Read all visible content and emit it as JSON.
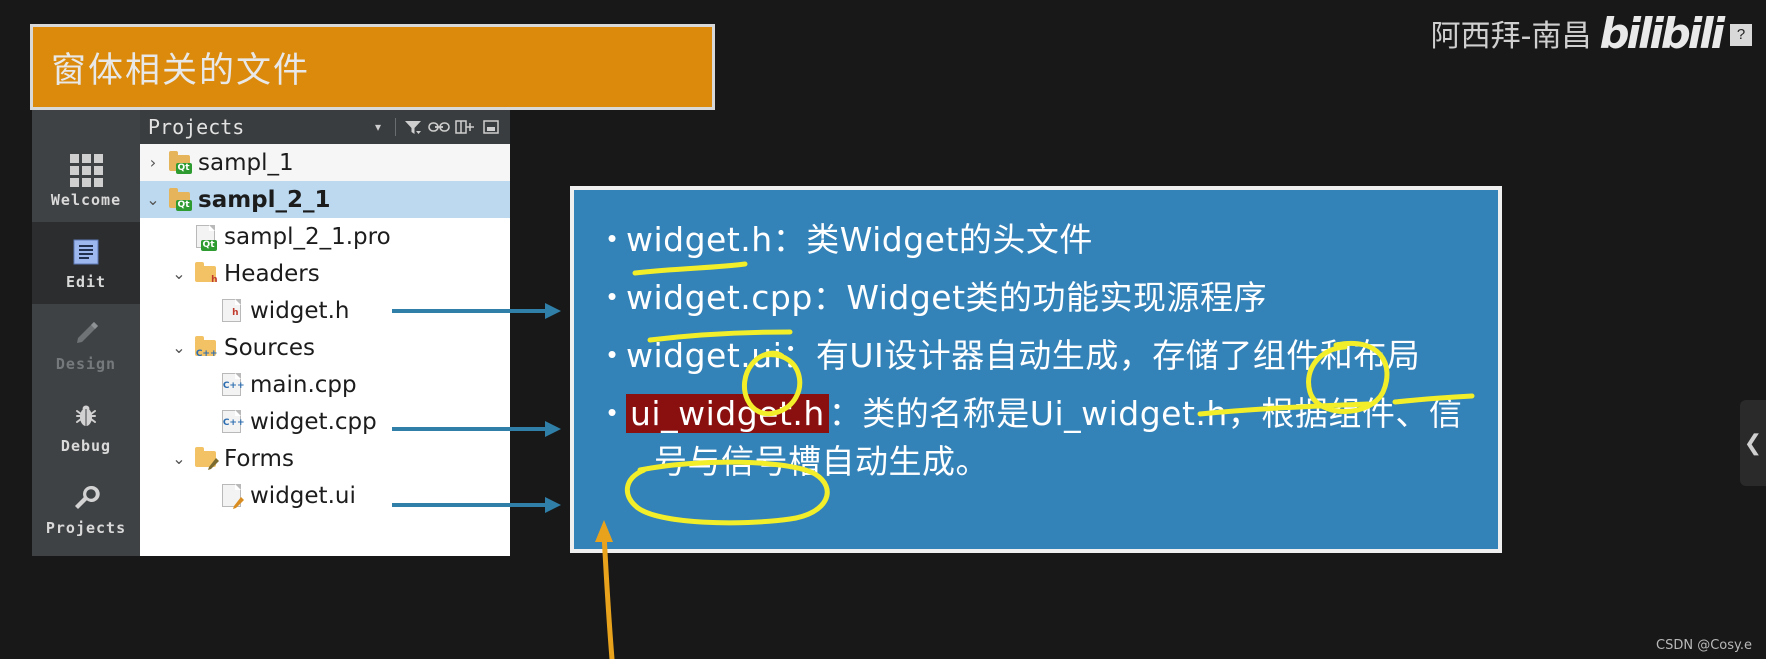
{
  "slide": {
    "title": "窗体相关的文件",
    "title_bg": "#DB8A0B",
    "panel_bg": "#3382B8"
  },
  "brand": {
    "author": "阿西拜-南昌",
    "logo": "bilibili",
    "badge": "?"
  },
  "qt_creator": {
    "modes": [
      {
        "label": "Welcome",
        "icon": "grid-icon",
        "state": "normal"
      },
      {
        "label": "Edit",
        "icon": "document-lines-icon",
        "state": "active"
      },
      {
        "label": "Design",
        "icon": "pencil-icon",
        "state": "disabled"
      },
      {
        "label": "Debug",
        "icon": "bug-icon",
        "state": "normal"
      },
      {
        "label": "Projects",
        "icon": "wrench-icon",
        "state": "normal"
      }
    ],
    "panel": {
      "title": "Projects",
      "toolbar": [
        {
          "name": "chevron-down-icon",
          "glyph": "▾"
        },
        {
          "name": "filter-icon",
          "glyph": "▼"
        },
        {
          "name": "link-icon",
          "glyph": "⊂⊃"
        },
        {
          "name": "split-add-icon",
          "glyph": "⊟"
        },
        {
          "name": "close-split-icon",
          "glyph": "⊡"
        }
      ]
    },
    "tree": [
      {
        "label": "sampl_1",
        "indent": 0,
        "twisty": "›",
        "icon": "qt-project-folder-icon",
        "selected": false,
        "bold": false
      },
      {
        "label": "sampl_2_1",
        "indent": 0,
        "twisty": "⌄",
        "icon": "qt-project-folder-icon",
        "selected": true,
        "bold": true
      },
      {
        "label": "sampl_2_1.pro",
        "indent": 1,
        "twisty": "",
        "icon": "qt-pro-file-icon",
        "selected": false,
        "bold": false
      },
      {
        "label": "Headers",
        "indent": 1,
        "twisty": "⌄",
        "icon": "headers-folder-icon",
        "selected": false,
        "bold": false
      },
      {
        "label": "widget.h",
        "indent": 2,
        "twisty": "",
        "icon": "h-file-icon",
        "selected": false,
        "bold": false
      },
      {
        "label": "Sources",
        "indent": 1,
        "twisty": "⌄",
        "icon": "sources-folder-icon",
        "selected": false,
        "bold": false
      },
      {
        "label": "main.cpp",
        "indent": 2,
        "twisty": "",
        "icon": "cpp-file-icon",
        "selected": false,
        "bold": false
      },
      {
        "label": "widget.cpp",
        "indent": 2,
        "twisty": "",
        "icon": "cpp-file-icon",
        "selected": false,
        "bold": false
      },
      {
        "label": "Forms",
        "indent": 1,
        "twisty": "⌄",
        "icon": "forms-folder-icon",
        "selected": false,
        "bold": false
      },
      {
        "label": "widget.ui",
        "indent": 2,
        "twisty": "",
        "icon": "ui-file-icon",
        "selected": false,
        "bold": false
      }
    ]
  },
  "content": {
    "bullets": [
      {
        "dot": "•",
        "name": "widget.h",
        "text": "widget.h：类Widget的头文件",
        "highlight": false
      },
      {
        "dot": "•",
        "name": "widget.cpp",
        "text": "widget.cpp：Widget类的功能实现源程序",
        "highlight": false
      },
      {
        "dot": "•",
        "name": "widget.ui",
        "text": "widget.ui：有UI设计器自动生成，存储了组件和布局",
        "highlight": false
      },
      {
        "dot": "•",
        "name": "ui_widget.h",
        "head": "ui_widget.h",
        "text": "：类的名称是Ui_widget.h，根据组件、信",
        "cont": "号与信号槽自动生成。",
        "highlight": true,
        "highlight_color": "#8a1010"
      }
    ]
  },
  "annotations": {
    "arrow_color": "#2f7fa8",
    "pen_yellow": "#f3ee2a",
    "pen_orange": "#e8a21c",
    "arrows": [
      {
        "name": "arrow-widget-h",
        "from_row": "widget.h"
      },
      {
        "name": "arrow-widget-cpp",
        "from_row": "widget.cpp"
      },
      {
        "name": "arrow-widget-ui",
        "from_row": "widget.ui"
      }
    ]
  },
  "edge_nav": {
    "glyph": "❮",
    "name": "prev-slide-button"
  },
  "watermark": "CSDN @Cosy.e"
}
